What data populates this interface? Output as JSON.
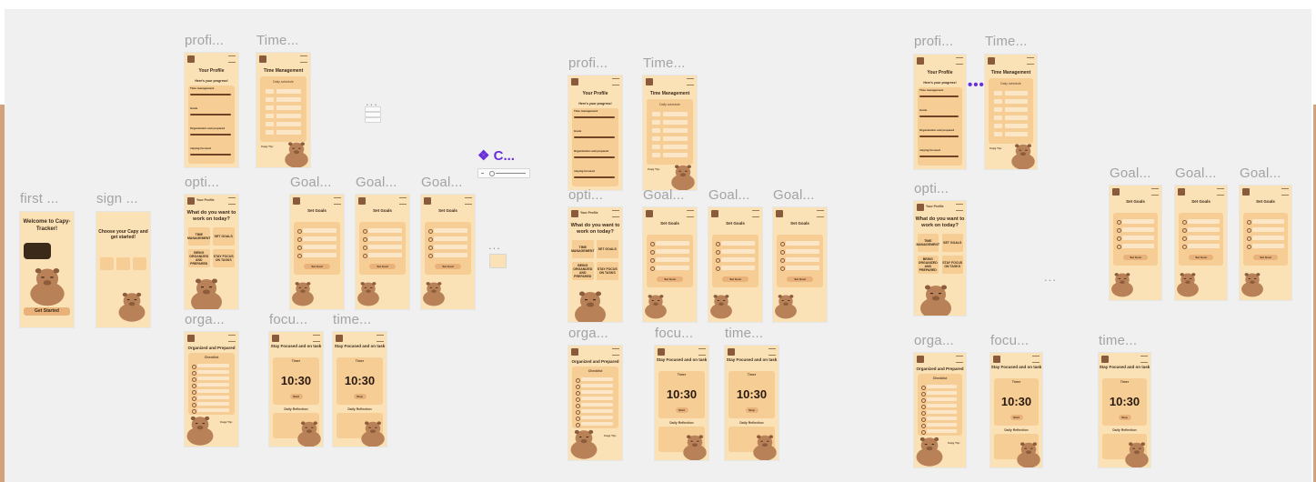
{
  "colors": {
    "canvas": "#f0f0f0",
    "side_accent": "#d4a17d",
    "frame_bg": "#fbe1b6",
    "panel": "#f6cd94",
    "capybara": "#b88157",
    "label_gray": "#a3a3a3",
    "component_purple": "#6a2fd8"
  },
  "frames": [
    {
      "label": "first ...",
      "type": "welcome",
      "title": "Welcome to Capy-Tracker!",
      "button": "Get Started"
    },
    {
      "label": "sign ...",
      "type": "signup",
      "title": "Choose your Capy and get started!"
    },
    {
      "label": "profi...",
      "type": "profile",
      "title": "Your Profile",
      "subtitle": "Here's your progress!",
      "sections": [
        "Time management",
        "Goals",
        "Organization and prepared",
        "staying focused"
      ]
    },
    {
      "label": "Time...",
      "type": "time",
      "title": "Time Management",
      "panel_title": "Daily schedule",
      "tip": "Capy Tip:"
    },
    {
      "label": "opti...",
      "type": "options",
      "title": "What do you want to work on today?",
      "tiles": [
        "TIME MANAGEMENT",
        "SET GOALS",
        "BEING ORGANIZED AND PREPARED",
        "STAY FOCUS ON TASKS"
      ],
      "header": "Your Profile"
    },
    {
      "label": "Goal...",
      "type": "goals",
      "title": "Set Goals",
      "button": "Set Goal"
    },
    {
      "label": "Goal...",
      "type": "goals",
      "title": "Set Goals",
      "button": "Set Goal"
    },
    {
      "label": "Goal...",
      "type": "goals",
      "title": "Set Goals",
      "button": "Set Goal"
    },
    {
      "label": "orga...",
      "type": "organized",
      "title": "Organized and Prepared",
      "panel_title": "Checklist",
      "tip": "Capy Tip:"
    },
    {
      "label": "focu...",
      "type": "focus",
      "title": "Stay Focused and on task",
      "timer_label": "Timer",
      "time": "10:30",
      "button": "Start",
      "reflection": "Daily Reflection"
    },
    {
      "label": "time...",
      "type": "focus",
      "title": "Stay Focused and on task",
      "timer_label": "Timer",
      "time": "10:30",
      "button": "Stop",
      "reflection": "Daily Reflection"
    },
    {
      "label": "profi...",
      "type": "profile",
      "title": "Your Profile",
      "subtitle": "Here's your progress!",
      "sections": [
        "Time management",
        "Goals",
        "Organization and prepared",
        "staying focused"
      ]
    },
    {
      "label": "Time...",
      "type": "time",
      "title": "Time Management",
      "panel_title": "Daily schedule",
      "tip": "Capy Tip:"
    },
    {
      "label": "opti...",
      "type": "options",
      "title": "What do you want to work on today?",
      "tiles": [
        "TIME MANAGEMENT",
        "SET GOALS",
        "BEING ORGANIZED AND PREPARED",
        "STAY FOCUS ON TASKS"
      ],
      "header": "Your Profile"
    },
    {
      "label": "Goal...",
      "type": "goals",
      "title": "Set Goals",
      "button": "Set Goal"
    },
    {
      "label": "Goal...",
      "type": "goals",
      "title": "Set Goals",
      "button": "Set Goal"
    },
    {
      "label": "Goal...",
      "type": "goals",
      "title": "Set Goals",
      "button": "Set Goal"
    },
    {
      "label": "orga...",
      "type": "organized",
      "title": "Organized and Prepared",
      "panel_title": "Checklist",
      "tip": "Capy Tip:"
    },
    {
      "label": "focu...",
      "type": "focus",
      "title": "Stay Focused and on task",
      "timer_label": "Timer",
      "time": "10:30",
      "button": "Start",
      "reflection": "Daily Reflection"
    },
    {
      "label": "time...",
      "type": "focus",
      "title": "Stay Focused and on task",
      "timer_label": "Timer",
      "time": "10:30",
      "button": "Stop",
      "reflection": "Daily Reflection"
    },
    {
      "label": "profi...",
      "type": "profile",
      "title": "Your Profile",
      "subtitle": "Here's your progress!",
      "sections": [
        "Time management",
        "Goals",
        "Organization and prepared",
        "staying focused"
      ]
    },
    {
      "label": "Time...",
      "type": "time",
      "title": "Time Management",
      "panel_title": "Daily schedule",
      "tip": "Capy Tip:"
    },
    {
      "label": "opti...",
      "type": "options",
      "title": "What do you want to work on today?",
      "tiles": [
        "TIME MANAGEMENT",
        "SET GOALS",
        "BEING ORGANIZED AND PREPARED",
        "STAY FOCUS ON TASKS"
      ],
      "header": "Your Profile"
    },
    {
      "label": "Goal...",
      "type": "goals",
      "title": "Set Goals",
      "button": "Set Goal"
    },
    {
      "label": "Goal...",
      "type": "goals",
      "title": "Set Goals",
      "button": "Set Goal"
    },
    {
      "label": "Goal...",
      "type": "goals",
      "title": "Set Goals",
      "button": "Set Goal"
    },
    {
      "label": "orga...",
      "type": "organized",
      "title": "Organized and Prepared",
      "panel_title": "Checklist",
      "tip": "Capy Tip:"
    },
    {
      "label": "focu...",
      "type": "focus",
      "title": "Stay Focused and on task",
      "timer_label": "Timer",
      "time": "10:30",
      "button": "Start",
      "reflection": "Daily Reflection"
    },
    {
      "label": "time...",
      "type": "focus",
      "title": "Stay Focused and on task",
      "timer_label": "Timer",
      "time": "10:30",
      "button": "Stop",
      "reflection": "Daily Reflection"
    }
  ],
  "component": {
    "label": "C...",
    "icon": "component-diamond-icon"
  },
  "ellipsis": "...",
  "purple_ellipsis": "•••"
}
